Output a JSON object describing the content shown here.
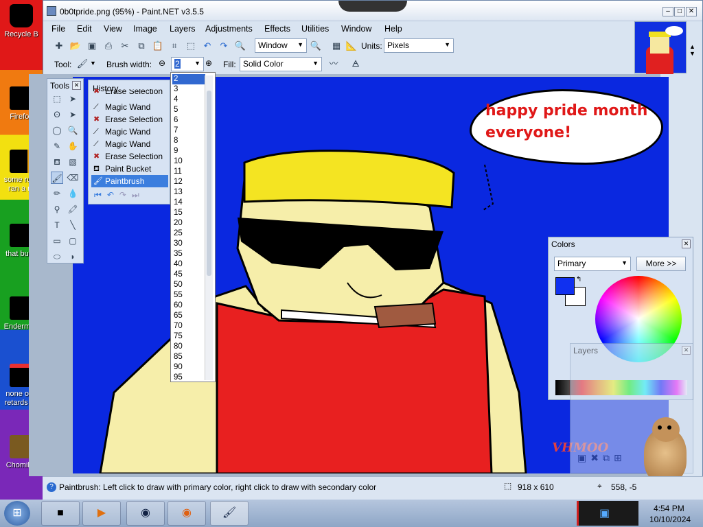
{
  "desktop": {
    "icons": [
      {
        "label": "Recycle B"
      },
      {
        "label": "Firefox"
      },
      {
        "label": "some russ",
        "label2": "ran a re"
      },
      {
        "label": "that but b"
      },
      {
        "label": "Enderman"
      },
      {
        "label": "none of y",
        "label2": "retards kn"
      },
      {
        "label": "ChomikB"
      }
    ]
  },
  "window": {
    "title": "0b0tpride.png (95%) - Paint.NET v3.5.5",
    "controls": {
      "min": "–",
      "max": "□",
      "close": "✕"
    }
  },
  "menu": [
    "File",
    "Edit",
    "View",
    "Image",
    "Layers",
    "Adjustments",
    "Effects",
    "Utilities",
    "Window",
    "Help"
  ],
  "toolbar": {
    "zoom_value": "Window",
    "units_label": "Units:",
    "units_value": "Pixels",
    "tool_label": "Tool:",
    "brush_width_label": "Brush width:",
    "brush_width_value": "2",
    "fill_label": "Fill:",
    "fill_value": "Solid Color"
  },
  "tools_panel": {
    "title": "Tools",
    "close": "✕"
  },
  "history_panel": {
    "title": "History",
    "items": [
      {
        "label": "Erase Selection",
        "icon": "x-icon"
      },
      {
        "label": "Magic Wand",
        "icon": "wand-icon"
      },
      {
        "label": "Erase Selection",
        "icon": "x-icon"
      },
      {
        "label": "Magic Wand",
        "icon": "wand-icon"
      },
      {
        "label": "Magic Wand",
        "icon": "wand-icon"
      },
      {
        "label": "Erase Selection",
        "icon": "x-icon"
      },
      {
        "label": "Paint Bucket",
        "icon": "bucket-icon"
      },
      {
        "label": "Paintbrush",
        "icon": "brush-icon",
        "selected": true
      }
    ]
  },
  "brush_dropdown": {
    "options": [
      "2",
      "3",
      "4",
      "5",
      "6",
      "7",
      "8",
      "9",
      "10",
      "11",
      "12",
      "13",
      "14",
      "15",
      "20",
      "25",
      "30",
      "35",
      "40",
      "45",
      "50",
      "55",
      "60",
      "65",
      "70",
      "75",
      "80",
      "85",
      "90",
      "95"
    ],
    "selected": "2"
  },
  "canvas_text": {
    "line1": "happy pride month",
    "line2": "everyone!",
    "watermark": "VHMOO"
  },
  "colors_panel": {
    "title": "Colors",
    "close": "✕",
    "mode": "Primary",
    "more_button": "More >>",
    "primary_color": "#1030f0",
    "secondary_color": "#ffffff"
  },
  "layers_panel": {
    "title": "Layers",
    "close": "✕"
  },
  "statusbar": {
    "message": "Paintbrush: Left click to draw with primary color, right click to draw with secondary color",
    "image_size": "918 x 610",
    "cursor_pos": "558, -5"
  },
  "taskbar": {
    "time": "4:54 PM",
    "date": "10/10/2024"
  }
}
